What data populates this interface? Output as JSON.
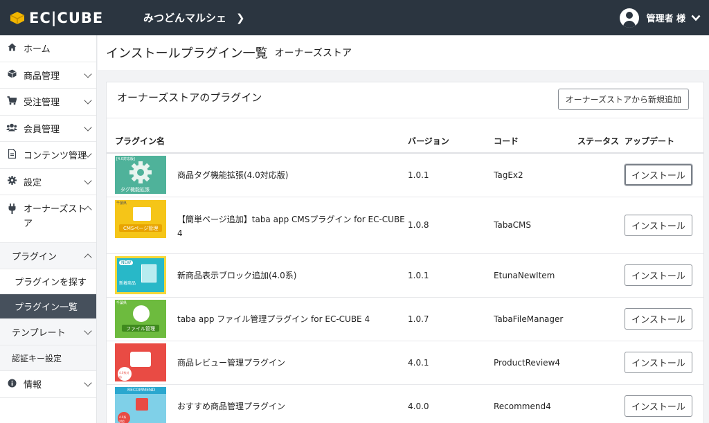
{
  "header": {
    "logo_text": "EC|CUBE",
    "shop_name": "みつどんマルシェ",
    "user_name": "管理者 様"
  },
  "sidebar": {
    "items": [
      {
        "label": "ホーム",
        "icon": "home-icon"
      },
      {
        "label": "商品管理",
        "icon": "box-icon"
      },
      {
        "label": "受注管理",
        "icon": "cart-icon"
      },
      {
        "label": "会員管理",
        "icon": "users-icon"
      },
      {
        "label": "コンテンツ管理",
        "icon": "file-icon"
      },
      {
        "label": "設定",
        "icon": "gear-icon"
      },
      {
        "label": "オーナーズストア",
        "icon": "plug-icon"
      }
    ],
    "plugin": "プラグイン",
    "plugin_find": "プラグインを探す",
    "plugin_list": "プラグイン一覧",
    "template": "テンプレート",
    "auth_key": "認証キー設定",
    "info": "情報"
  },
  "page": {
    "title": "インストールプラグイン一覧",
    "subtitle": "オーナーズストア"
  },
  "card": {
    "title": "オーナーズストアのプラグイン",
    "add_button": "オーナーズストアから新規追加"
  },
  "table": {
    "headers": {
      "name": "プラグイン名",
      "version": "バージョン",
      "code": "コード",
      "status": "ステータス",
      "update": "アップデート"
    },
    "rows": [
      {
        "name": "商品タグ機能拡張(4.0対応版)",
        "version": "1.0.1",
        "code": "TagEx2",
        "button": "インストール"
      },
      {
        "name": "【簡単ページ追加】taba app CMSプラグイン for EC-CUBE 4",
        "version": "1.0.8",
        "code": "TabaCMS",
        "button": "インストール"
      },
      {
        "name": "新商品表示ブロック追加(4.0系)",
        "version": "1.0.1",
        "code": "EtunaNewItem",
        "button": "インストール"
      },
      {
        "name": "taba app ファイル管理プラグイン for EC-CUBE 4",
        "version": "1.0.7",
        "code": "TabaFileManager",
        "button": "インストール"
      },
      {
        "name": "商品レビュー管理プラグイン",
        "version": "4.0.1",
        "code": "ProductReview4",
        "button": "インストール"
      },
      {
        "name": "おすすめ商品管理プラグイン",
        "version": "4.0.0",
        "code": "Recommend4",
        "button": "インストール"
      }
    ]
  },
  "thumbs": {
    "t1": {
      "tag": "[4.0対応版]",
      "label": "タグ機能拡張"
    },
    "t2": {
      "tag": "千葉県",
      "label": "CMSページ管理"
    },
    "t3": {
      "tag": "NEW",
      "label": "新着商品"
    },
    "t4": {
      "tag": "千葉県",
      "label": "ファイル管理"
    },
    "t5": {
      "tag": "4.0系対応"
    },
    "t6": {
      "tag": "RECOMMEND",
      "badge": "4.0系対応"
    }
  }
}
